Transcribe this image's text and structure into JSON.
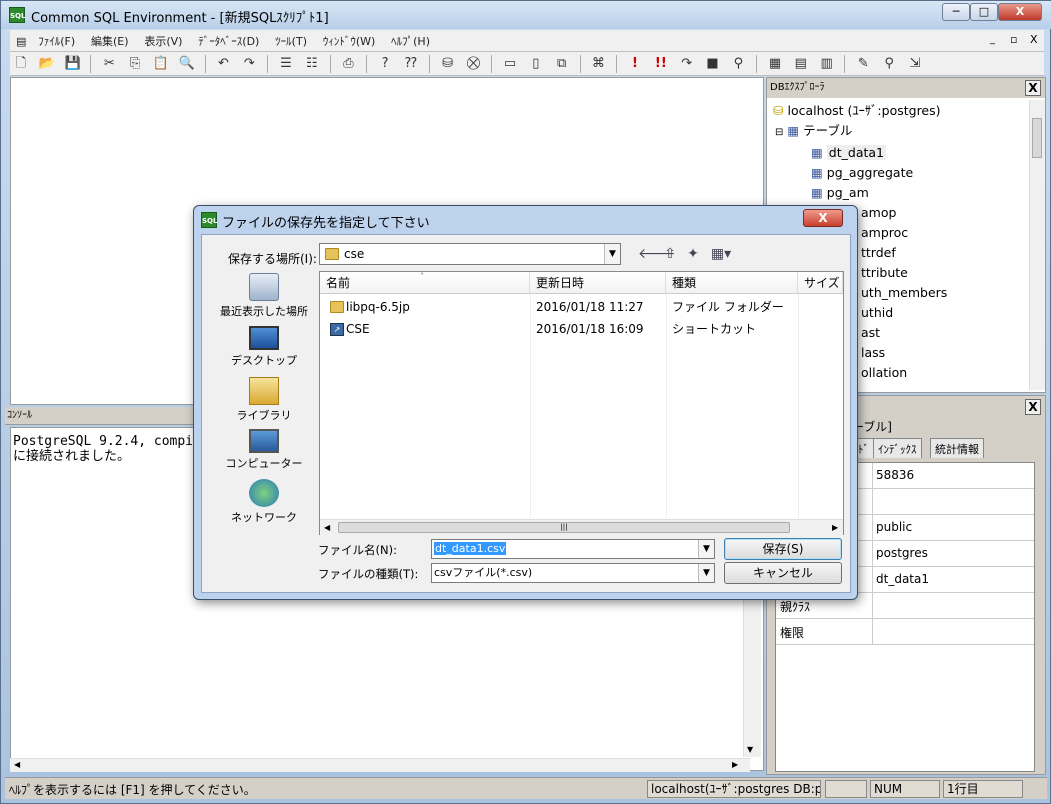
{
  "window": {
    "title": "Common SQL Environment - [新規SQLｽｸﾘﾌﾟﾄ1]",
    "app_icon_text": "SQL",
    "minimize": "─",
    "maximize": "□",
    "close": "X"
  },
  "menu": {
    "items": [
      "ﾌｧｲﾙ(F)",
      "編集(E)",
      "表示(V)",
      "ﾃﾞｰﾀﾍﾞｰｽ(D)",
      "ﾂｰﾙ(T)",
      "ｳｨﾝﾄﾞｳ(W)",
      "ﾍﾙﾌﾟ(H)"
    ],
    "child_min": "_",
    "child_restore": "▫",
    "child_close": "X"
  },
  "console": {
    "title": "ｺﾝｿｰﾙ",
    "text": "PostgreSQL 9.2.4, compi\nに接続されました。"
  },
  "explorer": {
    "title": "DBｴｸｽﾌﾟﾛｰﾗ",
    "close": "X",
    "root": "localhost (ﾕｰｻﾞ:postgres)",
    "tables_label": "テーブル",
    "tables": [
      "dt_data1",
      "pg_aggregate",
      "pg_am",
      "pg_amop",
      "pg_amproc",
      "pg_attrdef",
      "pg_attribute",
      "pg_auth_members",
      "pg_authid",
      "pg_cast",
      "pg_class",
      "pg_collation"
    ],
    "tables_visible_tail": [
      "",
      "",
      "",
      "amop",
      "amproc",
      "ttrdef",
      "ttribute",
      "uth_members",
      "uthid",
      "ast",
      "lass",
      "ollation"
    ]
  },
  "properties": {
    "header_tail": "ーブル]",
    "tabs": [
      "ﾄﾞ",
      "ｲﾝﾃﾞｯｸｽ",
      "統計情報"
    ],
    "rows": [
      {
        "key": "",
        "value": "58836"
      },
      {
        "key": "",
        "value": ""
      },
      {
        "key": "",
        "value": "public"
      },
      {
        "key": "",
        "value": "postgres"
      },
      {
        "key": "",
        "value": "dt_data1"
      },
      {
        "key": "親ｸﾗｽ",
        "value": ""
      },
      {
        "key": "権限",
        "value": ""
      }
    ],
    "close": "X"
  },
  "statusbar": {
    "help": "ﾍﾙﾌﾟを表示するには [F1] を押してください。",
    "connection": "localhost(ﾕｰｻﾞ:postgres DB:p",
    "num": "NUM",
    "line": "1行目"
  },
  "dialog": {
    "title": "ファイルの保存先を指定して下さい",
    "close": "X",
    "location_label": "保存する場所(I):",
    "location_value": "cse",
    "places": [
      "最近表示した場所",
      "デスクトップ",
      "ライブラリ",
      "コンピューター",
      "ネットワーク"
    ],
    "columns": [
      "名前",
      "更新日時",
      "種類",
      "サイズ"
    ],
    "files": [
      {
        "name": "libpq-6.5jp",
        "date": "2016/01/18 11:27",
        "type": "ファイル フォルダー",
        "icon": "folder-icon"
      },
      {
        "name": "CSE",
        "date": "2016/01/18 16:09",
        "type": "ショートカット",
        "icon": "shortcut-icon"
      }
    ],
    "filename_label": "ファイル名(N):",
    "filename_value": "dt_data1.csv",
    "filetype_label": "ファイルの種類(T):",
    "filetype_value": "csvファイル(*.csv)",
    "save_button": "保存(S)",
    "cancel_button": "キャンセル"
  }
}
